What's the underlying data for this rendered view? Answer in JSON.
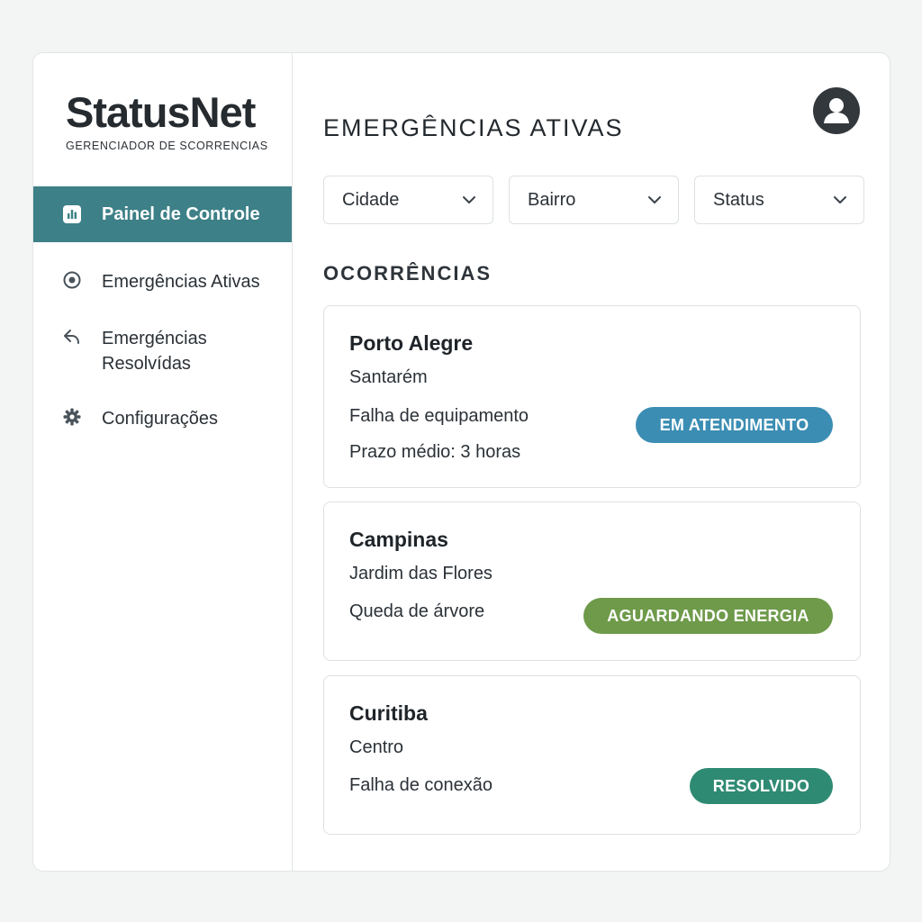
{
  "brand": {
    "name": "StatusNet",
    "subtitle": "GERENCIADOR DE SCORRENCIAS"
  },
  "sidebar": {
    "items": [
      {
        "label": "Painel de Controle",
        "icon": "bar-chart-icon",
        "active": true
      },
      {
        "label": "Emergências Ativas",
        "icon": "target-icon",
        "active": false
      },
      {
        "label": "Emergéncias Resolvídas",
        "icon": "reply-arrow-icon",
        "active": false
      },
      {
        "label": "Configurações",
        "icon": "gear-icon",
        "active": false
      }
    ]
  },
  "header": {
    "title": "EMERGÊNCIAS ATIVAS",
    "avatar_icon": "user-avatar-icon"
  },
  "filters": [
    {
      "label": "Cidade",
      "icon": "chevron-down-icon"
    },
    {
      "label": "Bairro",
      "icon": "chevron-down-icon"
    },
    {
      "label": "Status",
      "icon": "chevron-down-icon"
    }
  ],
  "section": {
    "title": "OCORRÊNCIAS"
  },
  "occurrences": [
    {
      "city": "Porto Alegre",
      "neighborhood": "Santarém",
      "issue": "Falha de equipamento",
      "deadline": "Prazo médio: 3 horas",
      "status": "EM ATENDIMENTO",
      "status_color": "#3b8db3"
    },
    {
      "city": "Campinas",
      "neighborhood": "Jardim das Flores",
      "issue": "Queda de árvore",
      "status": "AGUARDANDO ENERGIA",
      "status_color": "#6e9a4a"
    },
    {
      "city": "Curitiba",
      "neighborhood": "Centro",
      "issue": "Falha de conexão",
      "status": "RESOLVIDO",
      "status_color": "#2f8a73"
    }
  ],
  "colors": {
    "accent": "#3d8087",
    "background": "#f3f4f4"
  }
}
